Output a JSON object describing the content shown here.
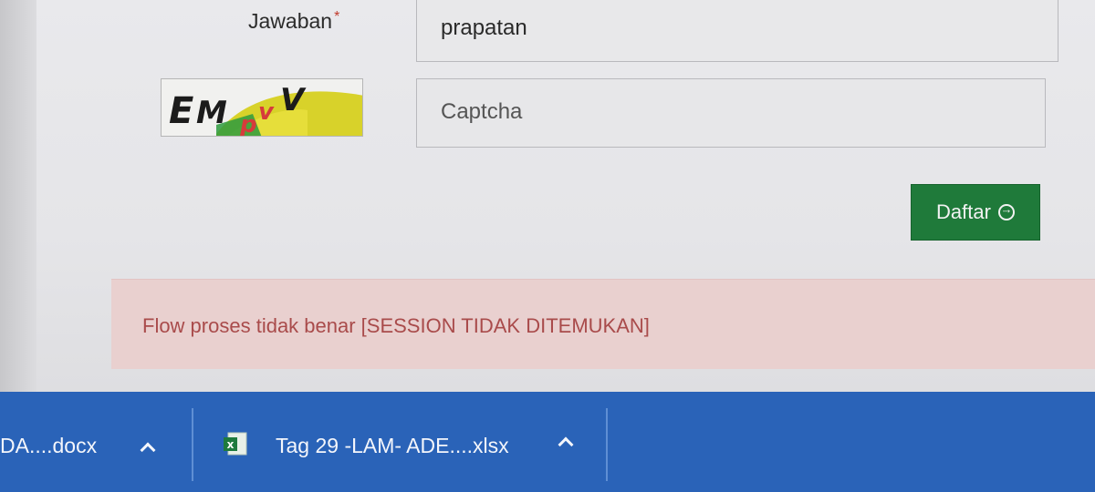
{
  "form": {
    "answer_label": "Jawaban",
    "required_mark": "*",
    "answer_value": "prapatan",
    "captcha_text": "EMpvV",
    "captcha_placeholder": "Captcha",
    "submit_label": "Daftar"
  },
  "alert": {
    "message": "Flow proses tidak benar [SESSION TIDAK DITEMUKAN]",
    "color": "#a94b4b"
  },
  "taskbar": {
    "items": [
      {
        "label": "DA....docx",
        "icon": "word-document-icon"
      },
      {
        "label": "Tag 29 -LAM- ADE....xlsx",
        "icon": "excel-file-icon"
      }
    ]
  },
  "colors": {
    "button": "#1f7a3a",
    "alert_bg": "#e9d0cf",
    "taskbar": "#2a63b8"
  }
}
